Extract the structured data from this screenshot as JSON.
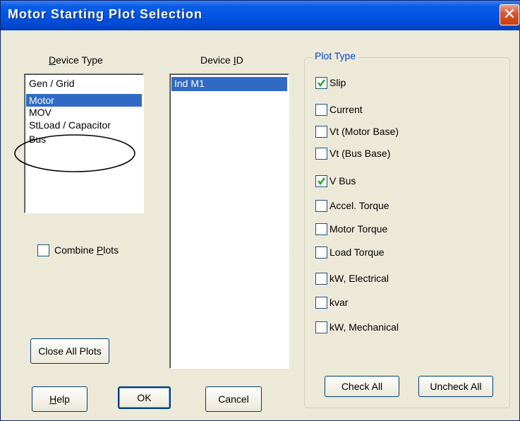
{
  "window": {
    "title": "Motor Starting Plot Selection",
    "close_glyph": "✕"
  },
  "device_type": {
    "label_pre": "",
    "label_u": "D",
    "label_post": "evice Type",
    "items": [
      "Gen / Grid",
      "Motor",
      "MOV",
      "StLoad / Capacitor",
      "Bus"
    ],
    "selected_index": 1
  },
  "device_id": {
    "label_pre": "Device ",
    "label_u": "I",
    "label_post": "D",
    "items": [
      "Ind M1"
    ],
    "selected_index": 0
  },
  "combine_plots": {
    "label_pre": "Combine ",
    "label_u": "P",
    "label_post": "lots",
    "checked": false
  },
  "plot_type": {
    "legend": "Plot Type",
    "options": [
      {
        "label": "Slip",
        "checked": true
      },
      {
        "label": "Current",
        "checked": false
      },
      {
        "label": "Vt (Motor Base)",
        "checked": false
      },
      {
        "label": "Vt (Bus Base)",
        "checked": false
      },
      {
        "label": "V Bus",
        "checked": true
      },
      {
        "label": "Accel. Torque",
        "checked": false
      },
      {
        "label": "Motor Torque",
        "checked": false
      },
      {
        "label": "Load Torque",
        "checked": false
      },
      {
        "label": "kW, Electrical",
        "checked": false
      },
      {
        "label": "kvar",
        "checked": false
      },
      {
        "label": "kW, Mechanical",
        "checked": false
      }
    ]
  },
  "buttons": {
    "close_all_plots": "Close All Plots",
    "help_u": "H",
    "help_post": "elp",
    "ok": "OK",
    "cancel": "Cancel",
    "check_all": "Check All",
    "uncheck_all": "Uncheck All"
  },
  "colors": {
    "selection": "#316ac5",
    "titlebar": "#0055e5",
    "accent_text": "#0046d5",
    "check": "#21a121"
  }
}
